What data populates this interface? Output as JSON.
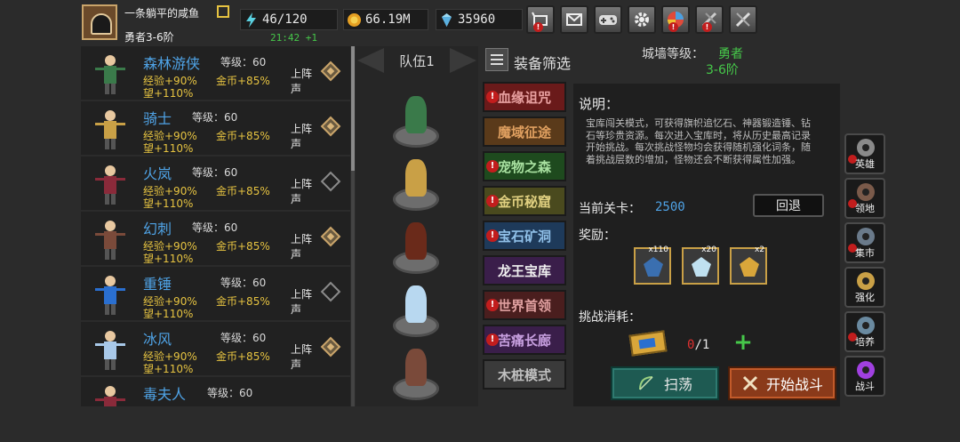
{
  "player": {
    "name": "一条躺平的咸鱼",
    "rank": "勇者3-6阶"
  },
  "resources": {
    "energy": "46/120",
    "gold": "66.19M",
    "gems": "35960",
    "timer": "21:42 +1"
  },
  "top_buttons": [
    "shop-icon",
    "mail-icon",
    "gamepad-icon",
    "gear-icon",
    "wheel-icon",
    "skill-icon",
    "sword-icon"
  ],
  "heroes": [
    {
      "name": "森林游侠",
      "level": "等级：60",
      "exp": "经验+90%",
      "gold": "金币+85%",
      "fame": "望+110%",
      "deploy": "上阵",
      "deploy2": "声",
      "deployed": true,
      "color": "#3a7a4a"
    },
    {
      "name": "骑士",
      "level": "等级：60",
      "exp": "经验+90%",
      "gold": "金币+85%",
      "fame": "望+110%",
      "deploy": "上阵",
      "deploy2": "声",
      "deployed": true,
      "color": "#c9a046"
    },
    {
      "name": "火岚",
      "level": "等级：60",
      "exp": "经验+90%",
      "gold": "金币+85%",
      "fame": "望+110%",
      "deploy": "上阵",
      "deploy2": "声",
      "deployed": false,
      "color": "#8a2a3a"
    },
    {
      "name": "幻刺",
      "level": "等级：60",
      "exp": "经验+90%",
      "gold": "金币+85%",
      "fame": "望+110%",
      "deploy": "上阵",
      "deploy2": "声",
      "deployed": true,
      "color": "#7a4a3a"
    },
    {
      "name": "重锤",
      "level": "等级：60",
      "exp": "经验+90%",
      "gold": "金币+85%",
      "fame": "望+110%",
      "deploy": "上阵",
      "deploy2": "声",
      "deployed": false,
      "color": "#2a6fd0"
    },
    {
      "name": "冰风",
      "level": "等级：60",
      "exp": "经验+90%",
      "gold": "金币+85%",
      "fame": "望+110%",
      "deploy": "上阵",
      "deploy2": "声",
      "deployed": true,
      "color": "#a8c8e8"
    },
    {
      "name": "毒夫人",
      "level": "等级：60",
      "exp": "",
      "gold": "",
      "fame": "",
      "deploy": "",
      "deploy2": "",
      "deployed": false,
      "color": "#8a2a3a"
    }
  ],
  "team": {
    "title": "队伍1",
    "slots": [
      "#3a7a4a",
      "#c9a046",
      "#6a2a1a",
      "#b8d8f0",
      "#7a4a3a"
    ]
  },
  "modes": [
    {
      "label": "血缘诅咒",
      "warn": true,
      "bg": "#6a1a1a",
      "color": "#e8a0a0"
    },
    {
      "label": "魔域征途",
      "warn": false,
      "bg": "#5a3a1a",
      "color": "#e0a060"
    },
    {
      "label": "宠物之森",
      "warn": true,
      "bg": "#1e4a1e",
      "color": "#a8e0a0"
    },
    {
      "label": "金币秘窟",
      "warn": true,
      "bg": "#4a4a1e",
      "color": "#e0d080"
    },
    {
      "label": "宝石矿洞",
      "warn": true,
      "bg": "#1e3a5a",
      "color": "#90c0e8"
    },
    {
      "label": "龙王宝库",
      "warn": false,
      "bg": "#3a1e4a",
      "color": "#f0f0f0"
    },
    {
      "label": "世界首领",
      "warn": true,
      "bg": "#4a1e1e",
      "color": "#e0a0a0"
    },
    {
      "label": "苦痛长廊",
      "warn": true,
      "bg": "#3a1e4a",
      "color": "#c8a0e0"
    },
    {
      "label": "木桩模式",
      "warn": false,
      "bg": "#3a3a3a",
      "color": "#c0c0c0"
    }
  ],
  "header": {
    "filter_label": "装备筛选",
    "wall_label": "城墙等级：",
    "wall_value": "勇者",
    "wall_stage": "3-6阶"
  },
  "info": {
    "heading": "说明：",
    "text": "宝库闯关模式，可获得旗帜追忆石、神器锻造锤、钻石等珍贵资源。每次进入宝库时，将从历史最高记录开始挑战。每次挑战怪物均会获得随机强化词条，随着挑战层数的增加，怪物还会不断获得属性加强。",
    "stage_label": "当前关卡：",
    "stage_value": "2500",
    "back_label": "回退",
    "reward_label": "奖励：",
    "rewards": [
      {
        "icon": "rune-stone-icon",
        "qty": "x110",
        "color": "#3a6fb0"
      },
      {
        "icon": "diamond-icon",
        "qty": "x20",
        "color": "#bfe0f0"
      },
      {
        "icon": "hammer-icon",
        "qty": "x2",
        "color": "#d9a63a"
      }
    ],
    "cost_label": "挑战消耗：",
    "cost_have": "0",
    "cost_need": "/1",
    "plus": "+",
    "sweep_label": "扫荡",
    "battle_label": "开始战斗"
  },
  "side_nav": [
    {
      "label": "英雄",
      "icon": "helmet-icon",
      "warn": true,
      "color": "#8a8a8a"
    },
    {
      "label": "领地",
      "icon": "castle-icon",
      "warn": true,
      "color": "#7a5a4a"
    },
    {
      "label": "集市",
      "icon": "market-icon",
      "warn": true,
      "color": "#6a7a8a"
    },
    {
      "label": "强化",
      "icon": "anvil-icon",
      "warn": false,
      "color": "#c9a046"
    },
    {
      "label": "培养",
      "icon": "potion-icon",
      "warn": true,
      "color": "#6a8aa0"
    },
    {
      "label": "战斗",
      "icon": "portal-icon",
      "warn": false,
      "color": "#a040e0"
    }
  ]
}
